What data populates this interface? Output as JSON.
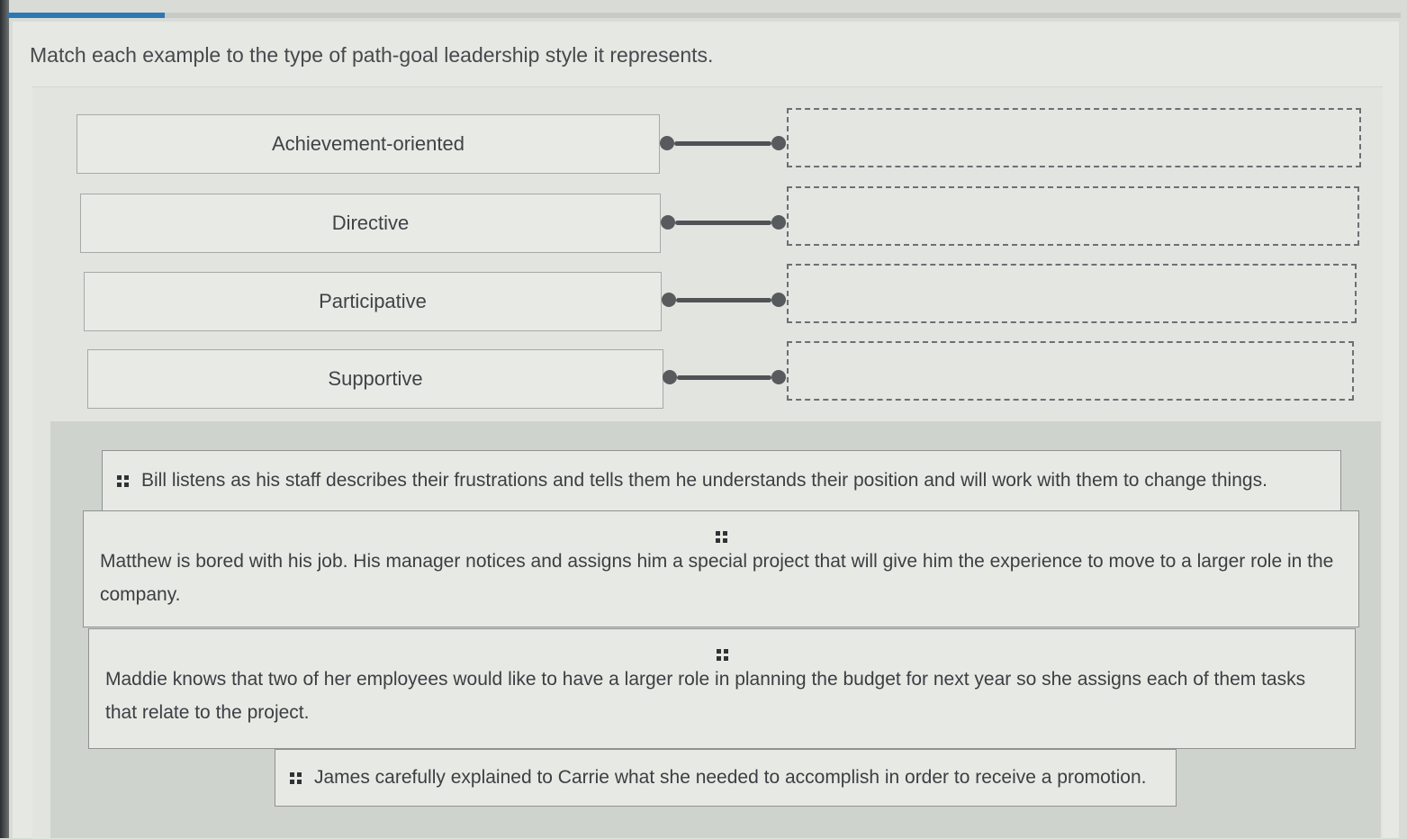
{
  "progress": {
    "value_fraction": 0.12,
    "fill_color": "#2e77b5"
  },
  "question": {
    "prompt": "Match each example to the type of path-goal leadership style it represents."
  },
  "targets": [
    {
      "label": "Achievement-oriented"
    },
    {
      "label": "Directive"
    },
    {
      "label": "Participative"
    },
    {
      "label": "Supportive"
    }
  ],
  "answers": [
    {
      "text": "Bill listens as his staff describes their frustrations and tells them he understands their position and will work with them to change things.",
      "icon": "grip-icon"
    },
    {
      "text": "Matthew is bored with his job. His manager notices and assigns him a special project that will give him the experience to move to a larger role in the company.",
      "icon": "grip-icon"
    },
    {
      "text": "Maddie knows that two of her employees would like to have a larger role in planning the budget for next year so she assigns each of them tasks that relate to the project.",
      "icon": "grip-icon"
    },
    {
      "text": "James carefully explained to Carrie what she needed to accomplish in order to receive a promotion.",
      "icon": "grip-icon"
    }
  ]
}
